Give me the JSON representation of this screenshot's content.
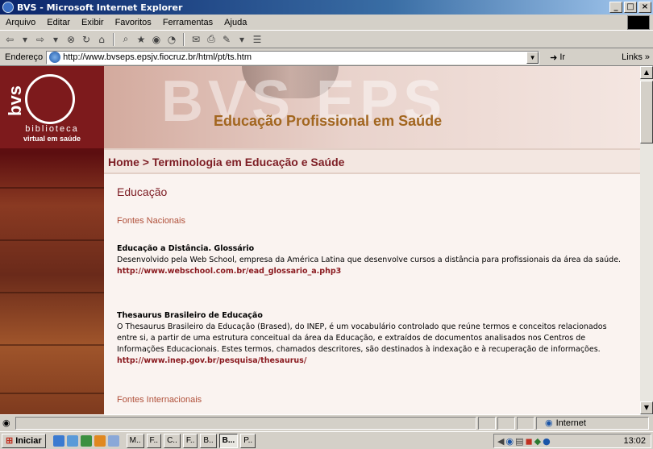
{
  "window": {
    "title": "BVS - Microsoft Internet Explorer",
    "min": "_",
    "max": "□",
    "close": "×"
  },
  "menu": [
    "Arquivo",
    "Editar",
    "Exibir",
    "Favoritos",
    "Ferramentas",
    "Ajuda"
  ],
  "address": {
    "label": "Endereço",
    "url": "http://www.bvseps.epsjv.fiocruz.br/html/pt/ts.htm",
    "go": "Ir",
    "links": "Links »"
  },
  "page": {
    "logo": {
      "bvs": "bvs",
      "line1": "biblioteca",
      "line2": "virtual em saúde"
    },
    "banner_title": "Educação Profissional em Saúde",
    "breadcrumb": "Home > Terminologia em Educação e Saúde",
    "heading": "Educação",
    "section_national": "Fontes Nacionais",
    "section_international": "Fontes Internacionais",
    "entries": [
      {
        "title": "Educação a Distância. Glossário",
        "desc": "Desenvolvido pela Web School, empresa da América Latina que desenvolve cursos a distância para profissionais da área da saúde.",
        "url": "http://www.webschool.com.br/ead_glossario_a.php3"
      },
      {
        "title": "Thesaurus Brasileiro de Educação",
        "desc": "O Thesaurus Brasileiro da Educação (Brased), do INEP, é um vocabulário controlado que reúne termos e conceitos relacionados entre si, a partir de uma estrutura conceitual da área da Educação, e extraídos de documentos analisados nos Centros de Informações Educacionais. Estes termos, chamados descritores, são destinados à indexação e à recuperação de informações.",
        "url": "http://www.inep.gov.br/pesquisa/thesaurus/"
      }
    ]
  },
  "status": {
    "zone": "Internet"
  },
  "taskbar": {
    "start": "Iniciar",
    "tasks": [
      "M..",
      "F..",
      "C..",
      "F..",
      "B..",
      "B...",
      "P.."
    ],
    "clock": "13:02"
  },
  "colors": {
    "accent_maroon": "#7d1d24",
    "banner_gold": "#a2661f",
    "section_orange": "#b0503a"
  }
}
